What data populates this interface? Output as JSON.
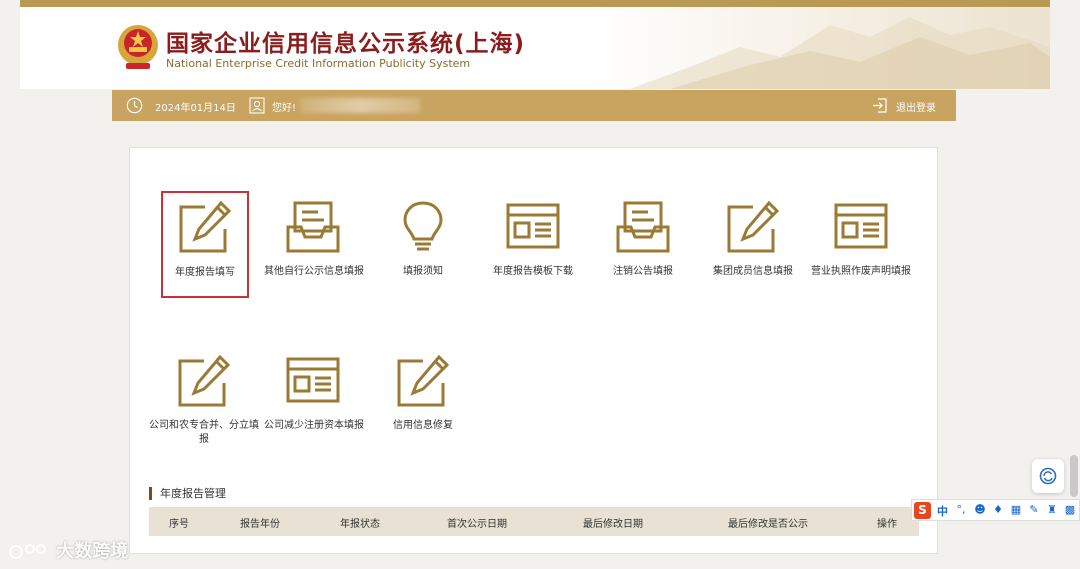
{
  "header": {
    "title": "国家企业信用信息公示系统(上海)",
    "subtitle": "National Enterprise Credit Information Publicity System"
  },
  "topbar": {
    "date": "2024年01月14日",
    "greeting": "您好!",
    "logout": "退出登录"
  },
  "tiles_row1": [
    {
      "label": "年度报告填写",
      "icon": "edit-icon"
    },
    {
      "label": "其他自行公示信息填报",
      "icon": "inbox-icon"
    },
    {
      "label": "填报须知",
      "icon": "lightbulb-icon"
    },
    {
      "label": "年度报告模板下载",
      "icon": "template-icon"
    },
    {
      "label": "注销公告填报",
      "icon": "inbox-icon"
    },
    {
      "label": "集团成员信息填报",
      "icon": "edit-icon"
    },
    {
      "label": "营业执照作废声明填报",
      "icon": "template-icon"
    }
  ],
  "tiles_row2": [
    {
      "label": "公司和农专合并、分立填报",
      "icon": "edit-icon"
    },
    {
      "label": "公司减少注册资本填报",
      "icon": "template-icon"
    },
    {
      "label": "信用信息修复",
      "icon": "edit-icon"
    }
  ],
  "section": {
    "title": "年度报告管理",
    "columns": [
      "序号",
      "报告年份",
      "年报状态",
      "首次公示日期",
      "最后修改日期",
      "最后修改是否公示",
      "操作"
    ]
  },
  "ime": {
    "logo": "S",
    "lang": "中"
  },
  "watermark": {
    "text": "大数跨境"
  },
  "colors": {
    "accent": "#b99953",
    "bar": "#c9a461",
    "selected": "#c8333a",
    "title": "#8b1c1c"
  }
}
